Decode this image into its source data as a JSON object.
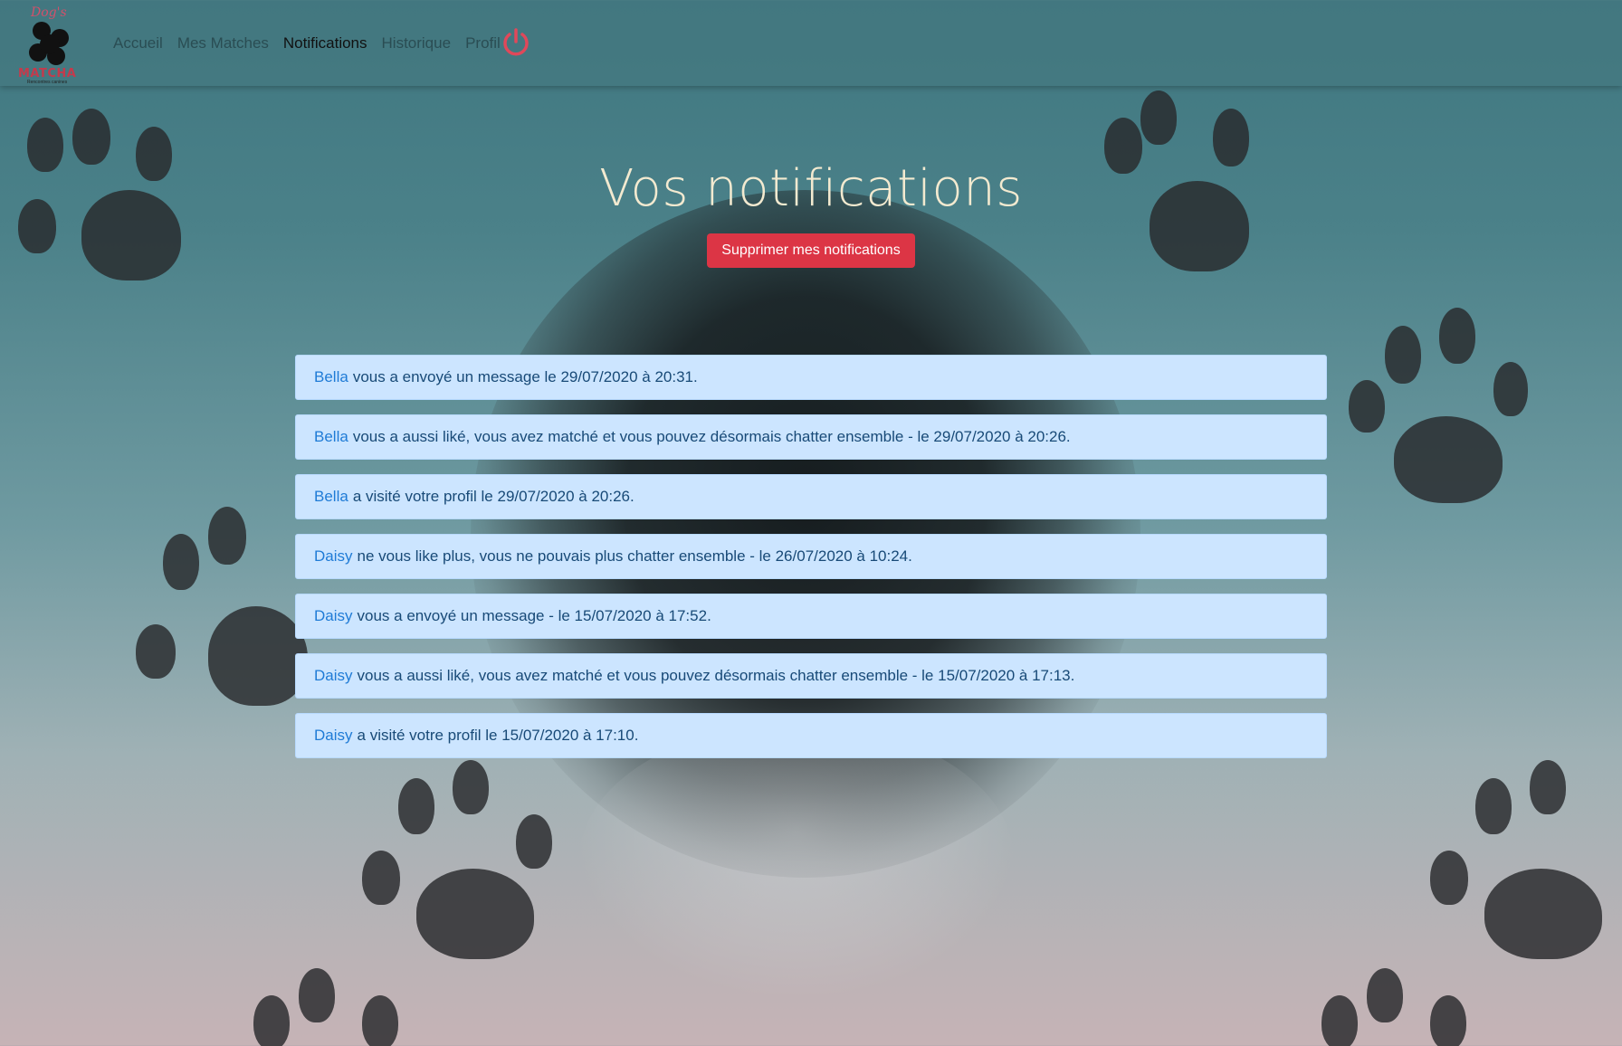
{
  "logo": {
    "top_text": "Dog's",
    "word": "MATCHA",
    "sub": "Rencontres canines"
  },
  "nav": {
    "items": [
      {
        "label": "Accueil"
      },
      {
        "label": "Mes Matches"
      },
      {
        "label": "Notifications",
        "active": true
      },
      {
        "label": "Historique"
      },
      {
        "label": "Profil"
      }
    ],
    "logout_icon": "power-icon"
  },
  "page": {
    "title": "Vos notifications",
    "delete_button": "Supprimer mes notifications"
  },
  "notifications": [
    {
      "user": "Bella",
      "text": "vous a envoyé un message le 29/07/2020 à 20:31."
    },
    {
      "user": "Bella",
      "text": "vous a aussi liké, vous avez matché et vous pouvez désormais chatter ensemble - le 29/07/2020 à 20:26."
    },
    {
      "user": "Bella",
      "text": "a visité votre profil le 29/07/2020 à 20:26."
    },
    {
      "user": "Daisy",
      "text": "ne vous like plus, vous ne pouvais plus chatter ensemble - le 26/07/2020 à 10:24."
    },
    {
      "user": "Daisy",
      "text": "vous a envoyé un message - le 15/07/2020 à 17:52."
    },
    {
      "user": "Daisy",
      "text": "vous a aussi liké, vous avez matché et vous pouvez désormais chatter ensemble - le 15/07/2020 à 17:13."
    },
    {
      "user": "Daisy",
      "text": "a visité votre profil le 15/07/2020 à 17:10."
    }
  ],
  "colors": {
    "danger": "#dc3545",
    "alert_bg": "#cce5ff",
    "link": "#1f7bd6",
    "title": "#f3ead0"
  }
}
